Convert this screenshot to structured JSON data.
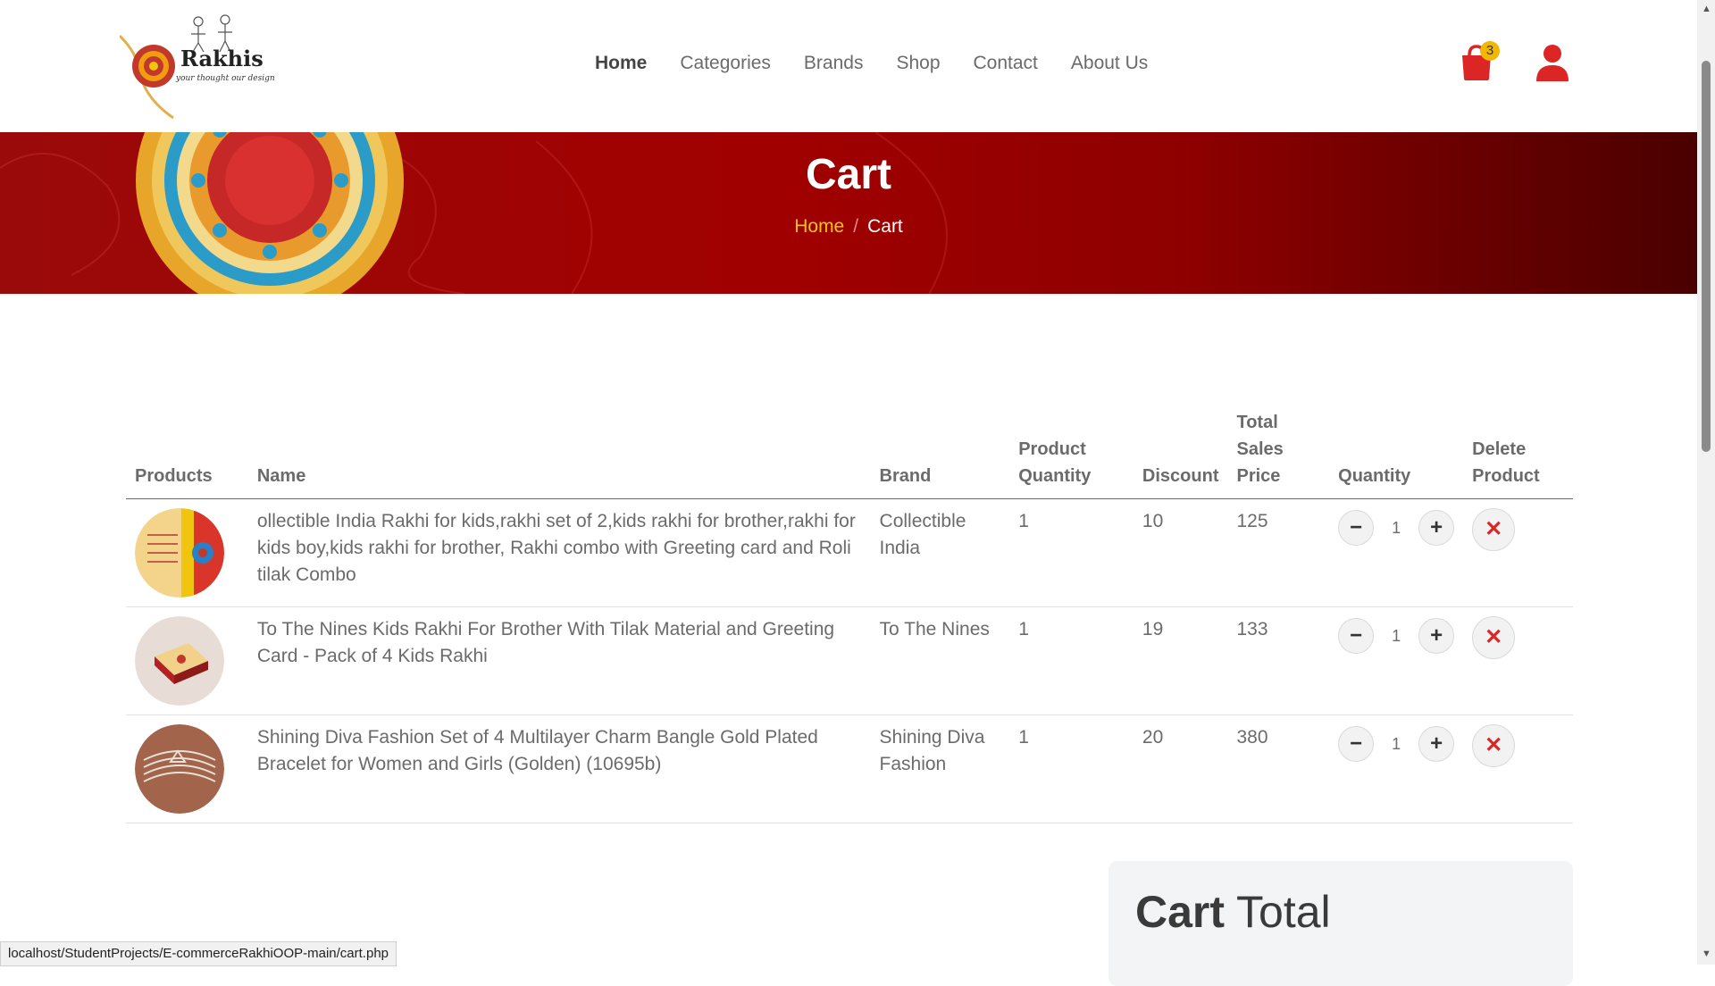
{
  "brand": {
    "name": "Rakhis",
    "tagline": "your thought our design"
  },
  "nav": [
    {
      "label": "Home",
      "active": true
    },
    {
      "label": "Categories",
      "active": false
    },
    {
      "label": "Brands",
      "active": false
    },
    {
      "label": "Shop",
      "active": false
    },
    {
      "label": "Contact",
      "active": false
    },
    {
      "label": "About Us",
      "active": false
    }
  ],
  "header": {
    "cart_count": "3",
    "cart_icon": "shopping-bag-icon",
    "user_icon": "user-icon"
  },
  "hero": {
    "title": "Cart",
    "breadcrumb": {
      "home": "Home",
      "separator": "/",
      "current": "Cart"
    }
  },
  "table": {
    "headers": {
      "products": "Products",
      "name": "Name",
      "brand": "Brand",
      "product_quantity": "Product Quantity",
      "discount": "Discount",
      "total_sales_price": "Total Sales Price",
      "quantity": "Quantity",
      "delete_product": "Delete Product"
    },
    "rows": [
      {
        "name": "ollectible India Rakhi for kids,rakhi set of 2,kids rakhi for brother,rakhi for kids boy,kids rakhi for brother, Rakhi combo with Greeting card and Roli tilak Combo",
        "brand": "Collectible India",
        "product_quantity": "1",
        "discount": "10",
        "total_sales_price": "125",
        "quantity": "1"
      },
      {
        "name": "To The Nines Kids Rakhi For Brother With Tilak Material and Greeting Card - Pack of 4 Kids Rakhi",
        "brand": "To The Nines",
        "product_quantity": "1",
        "discount": "19",
        "total_sales_price": "133",
        "quantity": "1"
      },
      {
        "name": "Shining Diva Fashion Set of 4 Multilayer Charm Bangle Gold Plated Bracelet for Women and Girls (Golden) (10695b)",
        "brand": "Shining Diva Fashion",
        "product_quantity": "1",
        "discount": "20",
        "total_sales_price": "380",
        "quantity": "1"
      }
    ]
  },
  "cart_total": {
    "title_bold": "Cart",
    "title_rest": "Total"
  },
  "status_bar": {
    "url": "localhost/StudentProjects/E-commerceRakhiOOP-main/cart.php"
  },
  "colors": {
    "accent_red": "#dc2626",
    "banner_red": "#a10000",
    "badge_yellow": "#f2b705",
    "breadcrumb_yellow": "#f5c518"
  }
}
